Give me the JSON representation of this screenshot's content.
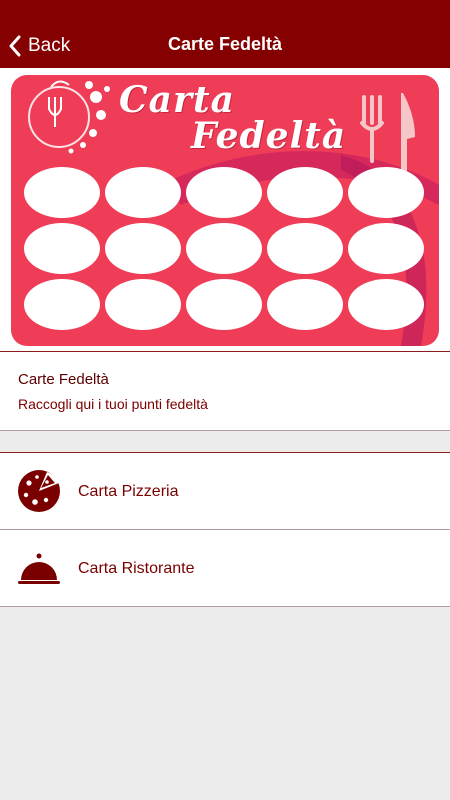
{
  "navbar": {
    "back_label": "Back",
    "title": "Carte Fedeltà"
  },
  "card_image": {
    "title_line1": "Carta",
    "title_line2": "Fedeltà",
    "stamp_count": 15
  },
  "info": {
    "title": "Carte Fedeltà",
    "subtitle": "Raccogli qui i tuoi punti fedeltà"
  },
  "menu": {
    "items": [
      {
        "label": "Carta Pizzeria",
        "icon": "pizza-icon"
      },
      {
        "label": "Carta Ristorante",
        "icon": "cloche-icon"
      }
    ]
  },
  "colors": {
    "navbar": "#850000",
    "card": "#ef3d57",
    "text_dark_red": "#7a0000",
    "background": "#ececec"
  }
}
